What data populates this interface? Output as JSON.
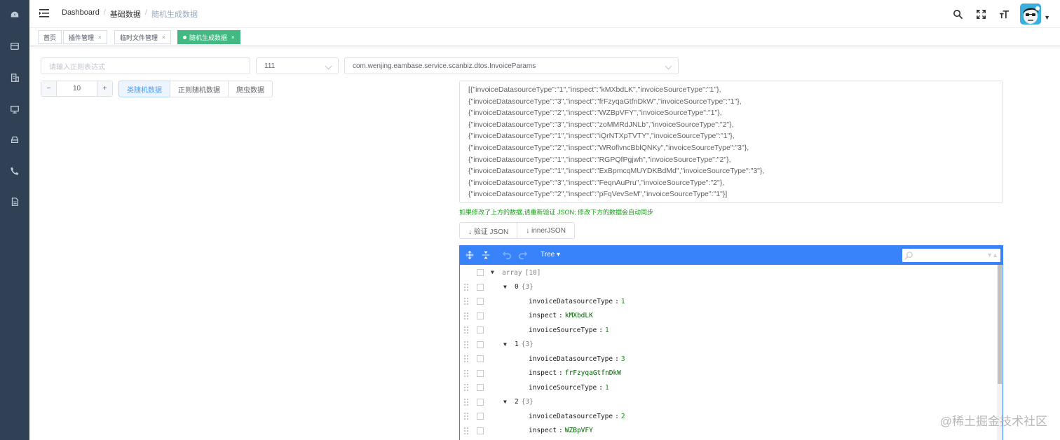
{
  "colors": {
    "sidebar_bg": "#304156",
    "active_tag": "#42b983",
    "editor_accent": "#3883fa"
  },
  "sidebar": {
    "icons": [
      "dashboard-icon",
      "inbox-icon",
      "building-icon",
      "monitor-icon",
      "cloud-drive-icon",
      "phone-icon",
      "document-icon"
    ]
  },
  "navbar": {
    "breadcrumb": [
      "Dashboard",
      "基础数据",
      "随机生成数据"
    ],
    "icons": [
      "search-icon",
      "fullscreen-icon",
      "font-size-icon"
    ]
  },
  "tags": [
    {
      "label": "首页"
    },
    {
      "label": "插件管理",
      "close": "×"
    },
    {
      "label": "临时文件管理",
      "close": "×"
    },
    {
      "label": "随机生成数据",
      "close": "×",
      "active": true
    }
  ],
  "form": {
    "regex_placeholder": "请输入正则表达式",
    "select_value": "111",
    "class_value": "com.wenjing.eambase.service.scanbiz.dtos.InvoiceParams",
    "count_minus": "−",
    "count_value": "10",
    "count_plus": "+",
    "mode_buttons": [
      "类随机数据",
      "正则随机数据",
      "爬虫数据"
    ]
  },
  "textarea_lines": [
    "[{\"invoiceDatasourceType\":\"1\",\"inspect\":\"kMXbdLK\",\"invoiceSourceType\":\"1\"},",
    "{\"invoiceDatasourceType\":\"3\",\"inspect\":\"frFzyqaGtfnDkW\",\"invoiceSourceType\":\"1\"},",
    "{\"invoiceDatasourceType\":\"2\",\"inspect\":\"WZBpVFY\",\"invoiceSourceType\":\"1\"},",
    "{\"invoiceDatasourceType\":\"3\",\"inspect\":\"zoMMRdJNLb\",\"invoiceSourceType\":\"2\"},",
    "{\"invoiceDatasourceType\":\"1\",\"inspect\":\"iQrNTXpTVTY\",\"invoiceSourceType\":\"1\"},",
    "{\"invoiceDatasourceType\":\"2\",\"inspect\":\"WRoflvncBblQNKy\",\"invoiceSourceType\":\"3\"},",
    "{\"invoiceDatasourceType\":\"1\",\"inspect\":\"RGPQfPgjwh\",\"invoiceSourceType\":\"2\"},",
    "{\"invoiceDatasourceType\":\"1\",\"inspect\":\"ExBpmcqMUYDKBdMd\",\"invoiceSourceType\":\"3\"},",
    "{\"invoiceDatasourceType\":\"3\",\"inspect\":\"FeqnAuPru\",\"invoiceSourceType\":\"2\"},",
    "{\"invoiceDatasourceType\":\"2\",\"inspect\":\"pFqVevSeM\",\"invoiceSourceType\":\"1\"}]"
  ],
  "hint": "如果修改了上方的数据,请重新验证 JSON; 修改下方的数据会自动同步",
  "json_buttons": [
    "↓ 验证 JSON",
    "↓ innerJSON"
  ],
  "editor": {
    "mode_label": "Tree ▾",
    "tree": [
      {
        "type": "root",
        "key": "array",
        "count": "[10]"
      },
      {
        "type": "obj",
        "key": "0",
        "count": "{3}"
      },
      {
        "type": "field",
        "key": "invoiceDatasourceType",
        "value": "1",
        "vtype": "num"
      },
      {
        "type": "field",
        "key": "inspect",
        "value": "kMXbdLK",
        "vtype": "str"
      },
      {
        "type": "field",
        "key": "invoiceSourceType",
        "value": "1",
        "vtype": "num"
      },
      {
        "type": "obj",
        "key": "1",
        "count": "{3}"
      },
      {
        "type": "field",
        "key": "invoiceDatasourceType",
        "value": "3",
        "vtype": "num"
      },
      {
        "type": "field",
        "key": "inspect",
        "value": "frFzyqaGtfnDkW",
        "vtype": "str"
      },
      {
        "type": "field",
        "key": "invoiceSourceType",
        "value": "1",
        "vtype": "num"
      },
      {
        "type": "obj",
        "key": "2",
        "count": "{3}"
      },
      {
        "type": "field",
        "key": "invoiceDatasourceType",
        "value": "2",
        "vtype": "num"
      },
      {
        "type": "field",
        "key": "inspect",
        "value": "WZBpVFY",
        "vtype": "str"
      }
    ]
  },
  "watermark": "@稀土掘金技术社区"
}
